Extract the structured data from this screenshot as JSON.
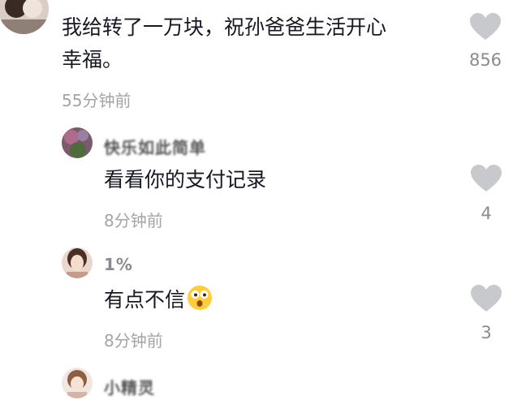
{
  "comments": [
    {
      "text_line1": "我给转了一万块，祝孙爸爸生活开心",
      "text_line2": "幸福。",
      "time": "55分钟前",
      "likes": "856",
      "avatar_icon": "user-avatar-photo"
    }
  ],
  "replies": [
    {
      "username": "快乐如此简单",
      "text": "看看你的支付记录",
      "time": "8分钟前",
      "likes": "4",
      "avatar_icon": "user-avatar-photo"
    },
    {
      "username": "1%",
      "text": "有点不信",
      "emoji": "surprised-emoji-icon",
      "time": "8分钟前",
      "likes": "3",
      "avatar_icon": "user-avatar-photo"
    },
    {
      "username": "小精灵",
      "avatar_icon": "user-avatar-photo"
    }
  ],
  "colors": {
    "text_primary": "#161823",
    "text_secondary": "#a3a4a8",
    "heart_gray": "#c8c9cc"
  }
}
